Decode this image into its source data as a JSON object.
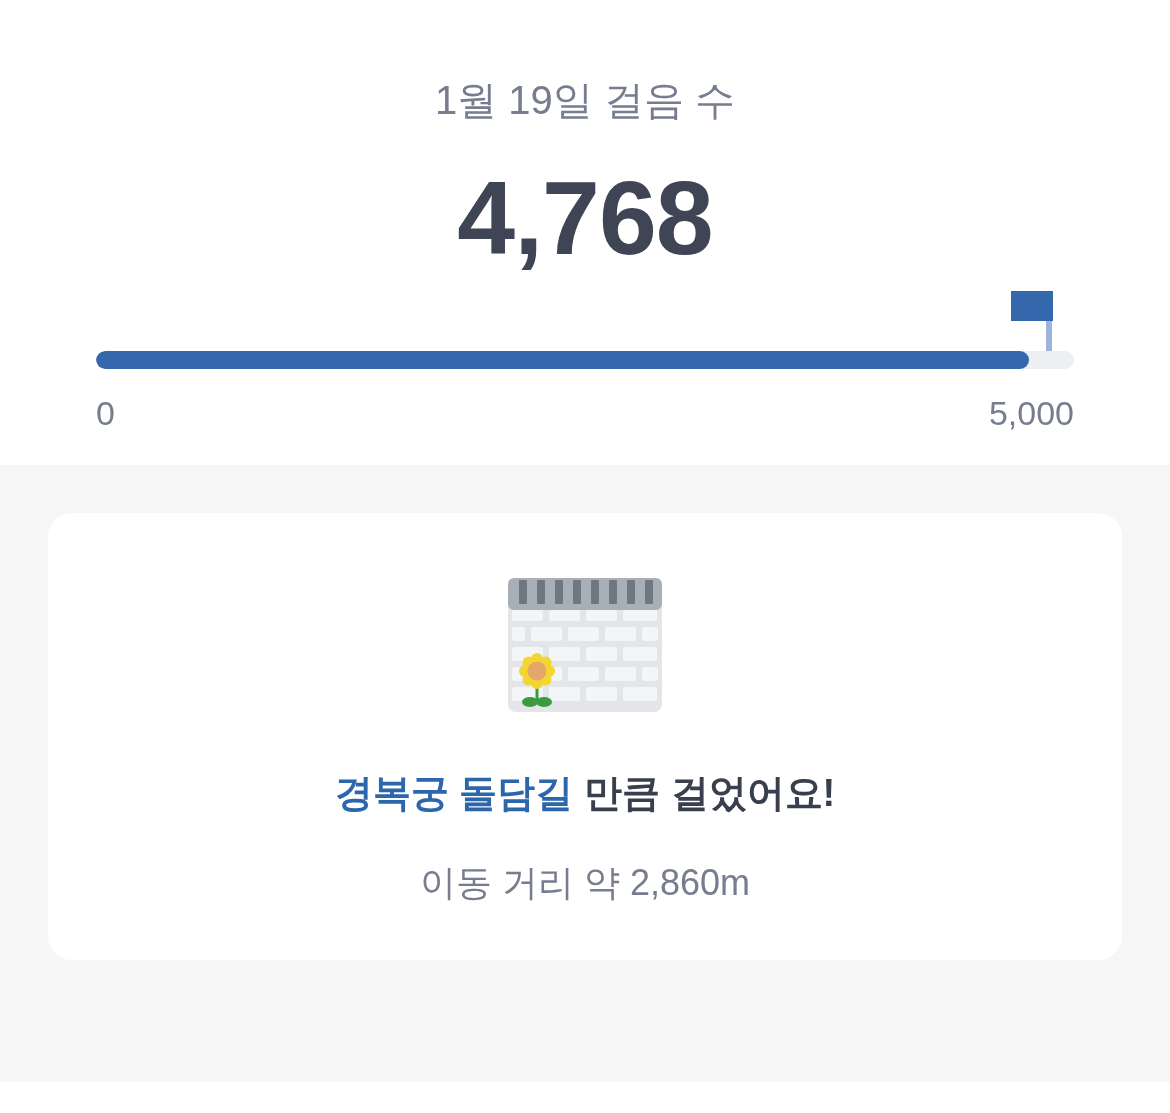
{
  "header": {
    "title": "1월 19일 걸음 수",
    "steps": "4,768"
  },
  "progress": {
    "level": 0.9536,
    "min_label": "0",
    "goal_label": "5,000"
  },
  "result": {
    "text": "**경복궁 돌담길** 만큼 걸었어요!",
    "distance": "이동 거리 약 2,860m"
  }
}
